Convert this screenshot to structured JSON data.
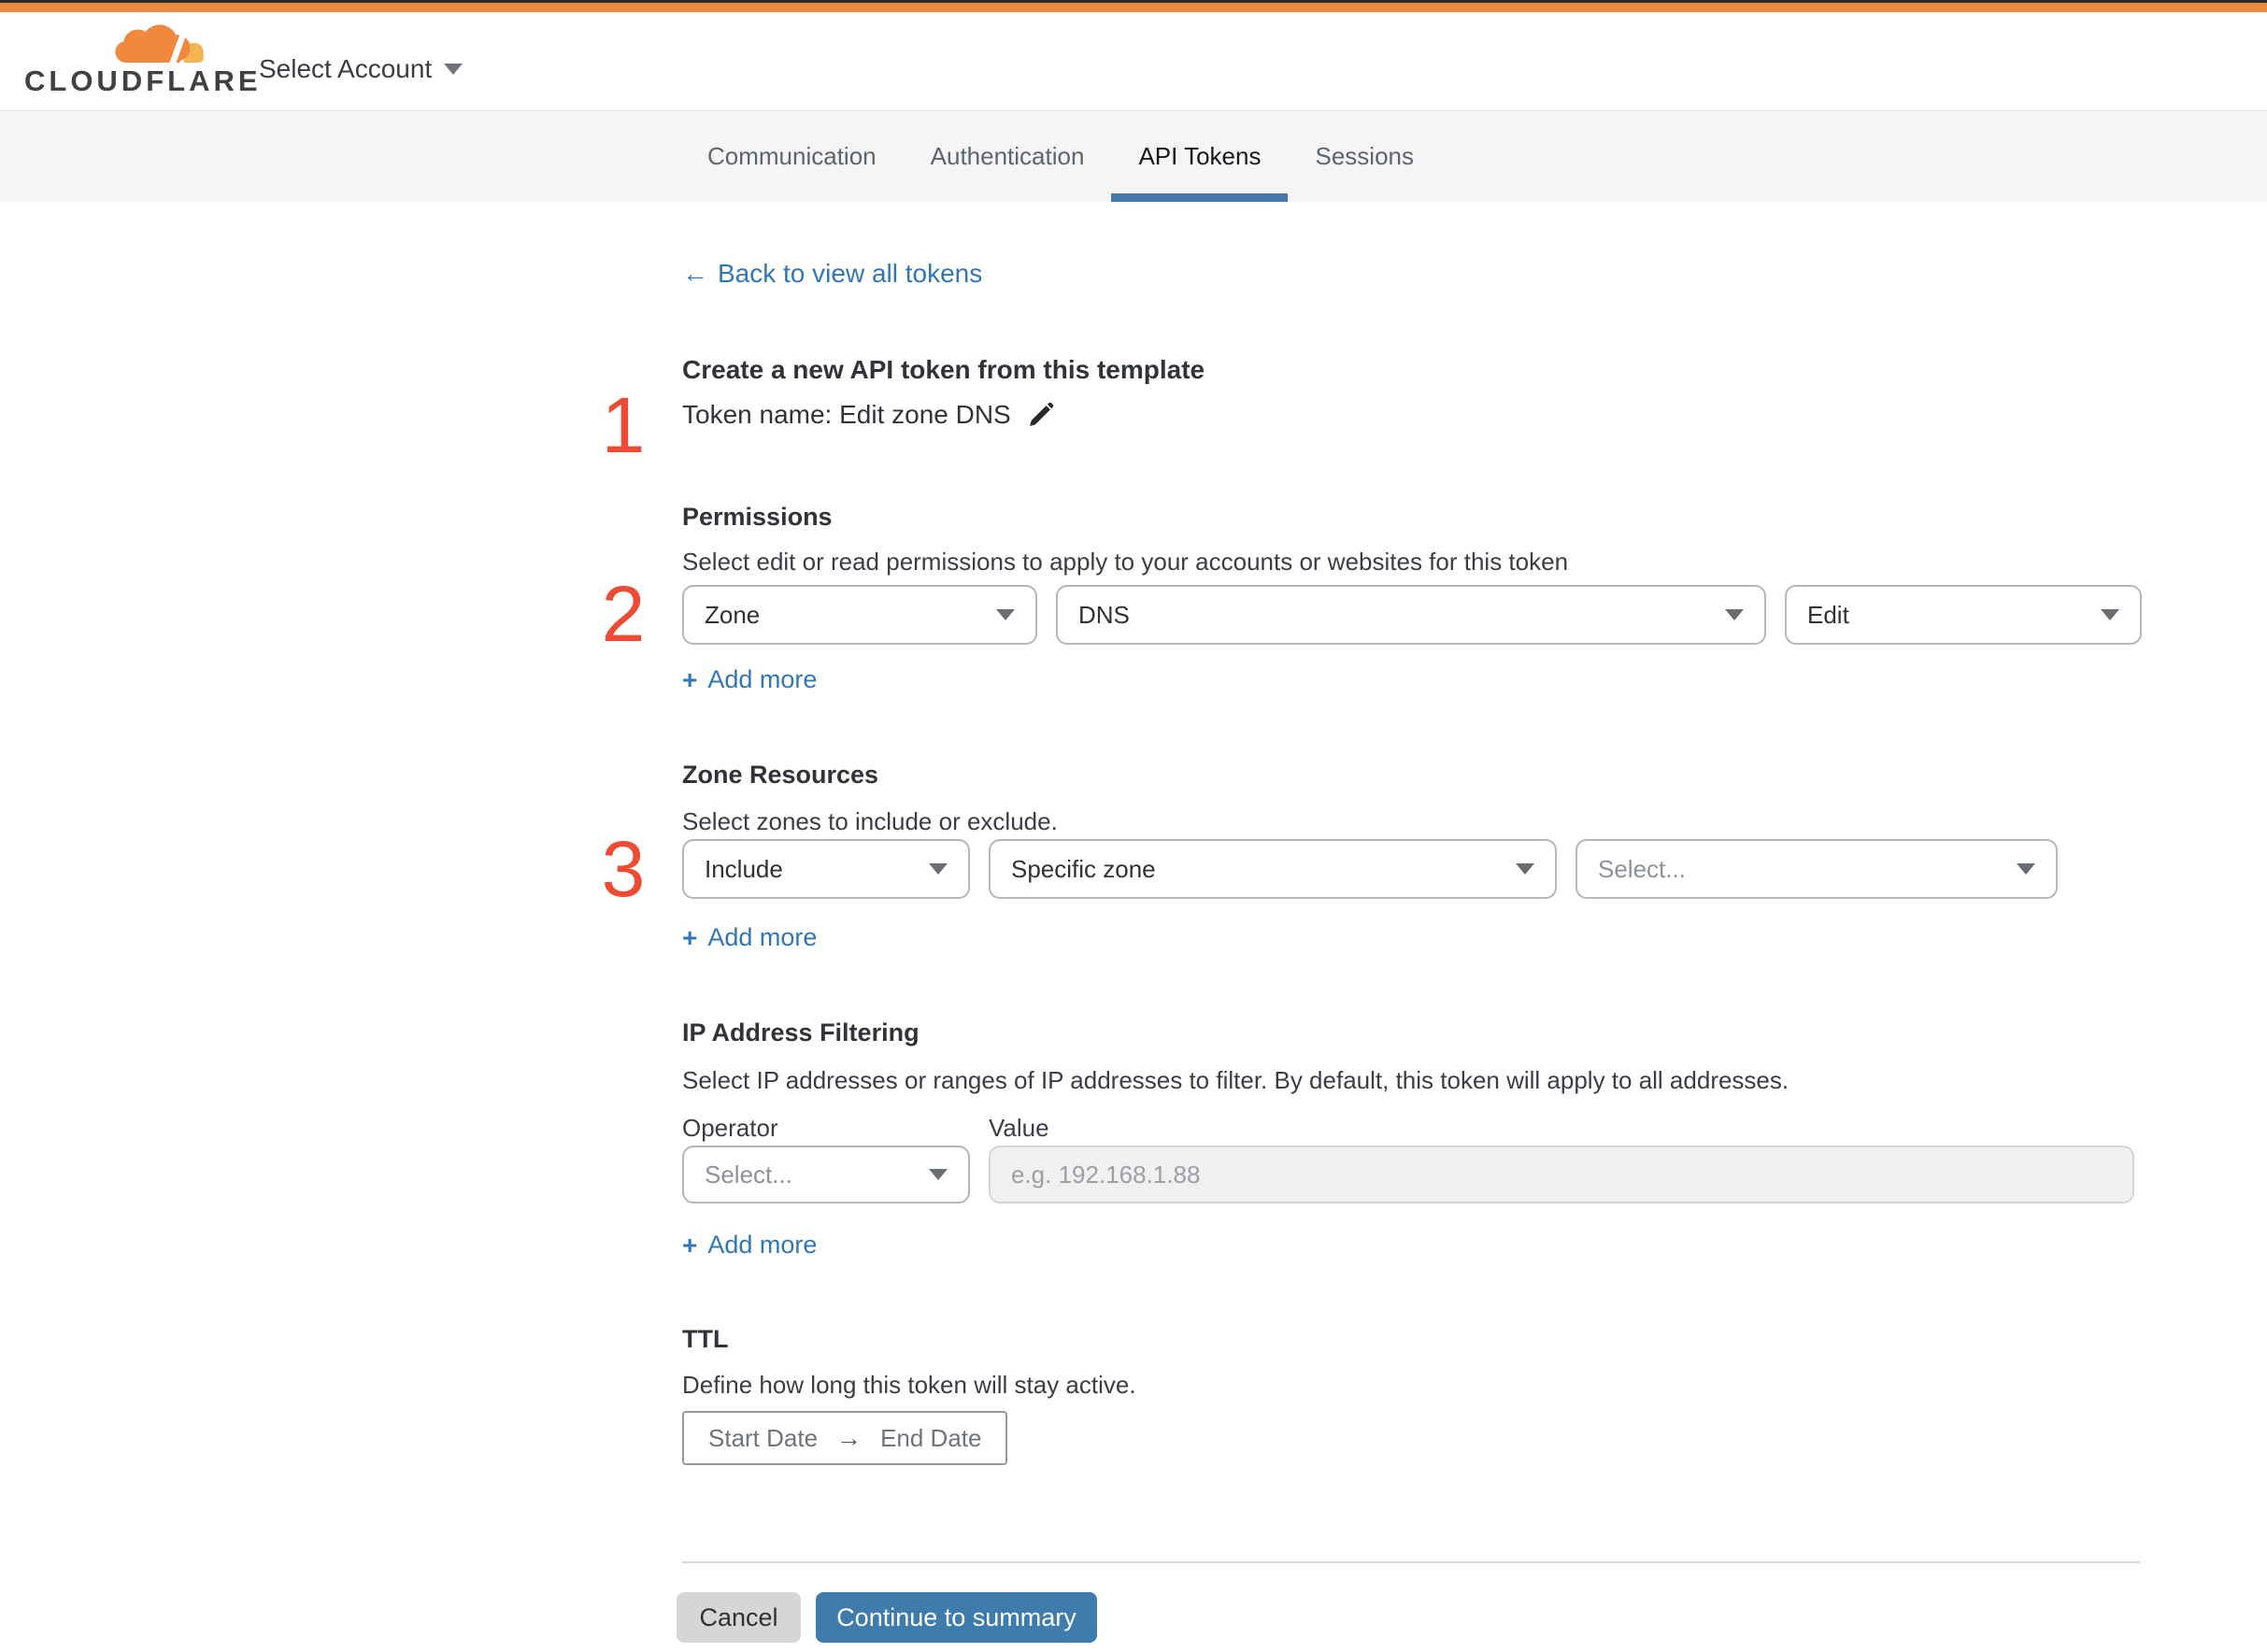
{
  "colors": {
    "topbar_dark": "#2B2A30",
    "brand_orange_bar": "#E98A3D",
    "brand_cloud_orange": "#F0883D",
    "brand_cloud_light": "#F6B352",
    "link_blue": "#3277B5",
    "button_blue": "#3E7CAE",
    "tab_underline_blue": "#4478A8",
    "step_number_red": "#EF4A33"
  },
  "header": {
    "brand": "CLOUDFLARE",
    "account_selector": "Select Account"
  },
  "tabs": {
    "items": [
      {
        "label": "Communication"
      },
      {
        "label": "Authentication"
      },
      {
        "label": "API Tokens"
      },
      {
        "label": "Sessions"
      }
    ],
    "active_tab": "API Tokens"
  },
  "back_link": {
    "arrow": "←",
    "label": "Back to view all tokens"
  },
  "steps": {
    "step1": "1",
    "step2": "2",
    "step3": "3"
  },
  "token_template": {
    "heading": "Create a new API token from this template",
    "token_name": "Token name: Edit zone DNS"
  },
  "permissions": {
    "heading": "Permissions",
    "description": "Select edit or read permissions to apply to your accounts or websites for this token",
    "scope": "Zone",
    "service": "DNS",
    "access": "Edit"
  },
  "zone_resources": {
    "heading": "Zone Resources",
    "description": "Select zones to include or exclude.",
    "mode": "Include",
    "type": "Specific zone",
    "zone_placeholder": "Select..."
  },
  "ip_filtering": {
    "heading": "IP Address Filtering",
    "description": "Select IP addresses or ranges of IP addresses to filter. By default, this token will apply to all addresses.",
    "operator_label": "Operator",
    "value_label": "Value",
    "operator_placeholder": "Select...",
    "value_placeholder": "e.g. 192.168.1.88"
  },
  "ttl": {
    "heading": "TTL",
    "description": "Define how long this token will stay active.",
    "start": "Start Date",
    "arrow": "→",
    "end": "End Date"
  },
  "actions": {
    "plus": "+",
    "add_more": "Add more",
    "cancel": "Cancel",
    "continue": "Continue to summary"
  }
}
